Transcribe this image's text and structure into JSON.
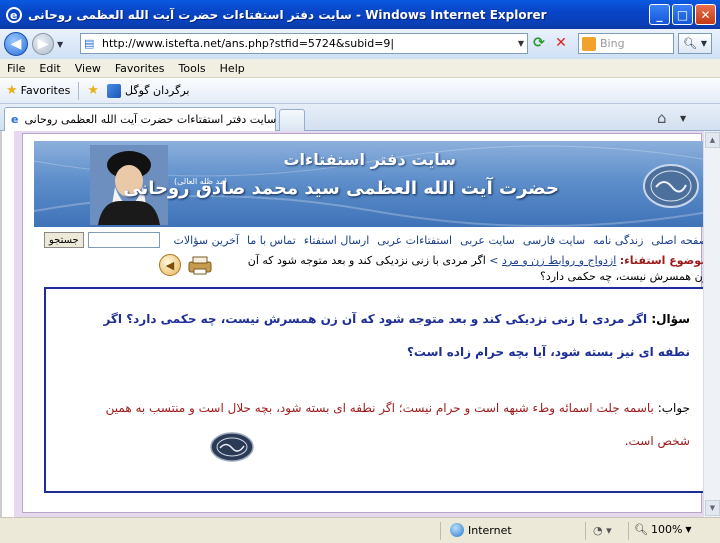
{
  "window": {
    "title": "سایت دفتر استفتاءات حضرت آیت الله العظمی روحانی - Windows Internet Explorer"
  },
  "address": {
    "url": "http://www.istefta.net/ans.php?stfid=5724&subid=9|",
    "search_placeholder": "Bing"
  },
  "menu": [
    "File",
    "Edit",
    "View",
    "Favorites",
    "Tools",
    "Help"
  ],
  "favorites": {
    "label": "Favorites",
    "link": "برگردان گوگل"
  },
  "tab": {
    "label": "سایت دفتر استفتاءات حضرت آیت الله العظمی روحانی"
  },
  "banner": {
    "site_title": "سایت دفتر استفتاءات",
    "person_name": "حضرت آیت الله العظمی سید محمد صادق روحانی",
    "honorific": "(مد ظله العالی)"
  },
  "nav": {
    "items": [
      "صفحه اصلی",
      "زندگی نامه",
      "سایت فارسی",
      "سایت عربی",
      "استفتاءات عربی",
      "ارسال استفتاء",
      "تماس با ما",
      "آخرین سؤالات"
    ],
    "search_button": "جستجو"
  },
  "subject": {
    "label": "موضوع استفتاء:",
    "category": "ازدواج و روابط زن و مرد",
    "arrow": ">",
    "text_line1": "اگر مردی با زنی نزدیکی کند و بعد متوجه شود که آن",
    "text_line2": "زن همسرش نیست، چه حکمی دارد؟"
  },
  "qa": {
    "question_label": "سؤال:",
    "question": "اگر مردی با زنی نزدیکی کند و بعد متوجه شود که آن زن همسرش نیست، چه حکمی دارد؟ اگر نطفه ای نیز بسته شود، آیا بچه حرام زاده است؟",
    "answer_label": "جواب:",
    "answer": "باسمه جلت اسمائه وطء شبهه است و حرام نیست؛ اگر نطفه ای بسته شود، بچه حلال است و منتسب به همین شخص است."
  },
  "status": {
    "zone": "Internet",
    "zoom": "100%"
  },
  "colors": {
    "titlebar": "#0a4fd6",
    "question_text": "#1d2f96",
    "answer_text": "#9c1a1a",
    "nav_link": "#1a3f8a",
    "page_bg": "#e6d9ee"
  }
}
